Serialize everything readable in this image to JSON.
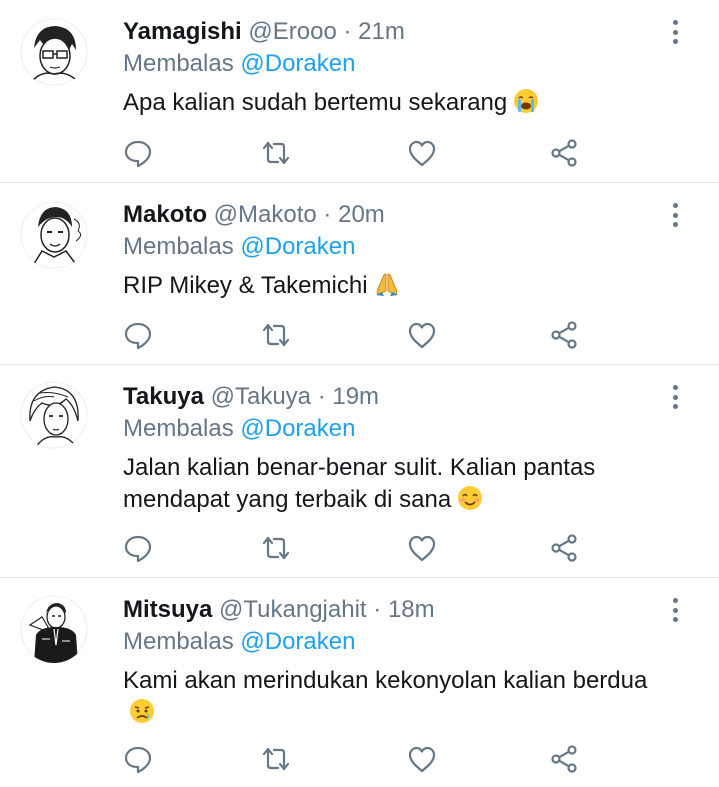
{
  "tweets": [
    {
      "name": "Yamagishi",
      "handle": "@Erooo",
      "separator": "·",
      "time": "21m",
      "reply_prefix": "Membalas",
      "reply_to": "@Doraken",
      "text": "Apa kalian sudah bertemu sekarang",
      "emoji": "loudly-crying-face",
      "avatar_icon": "manga-avatar-glasses"
    },
    {
      "name": "Makoto",
      "handle": "@Makoto",
      "separator": "·",
      "time": "20m",
      "reply_prefix": "Membalas",
      "reply_to": "@Doraken",
      "text": "RIP Mikey & Takemichi",
      "emoji": "folded-hands",
      "avatar_icon": "manga-avatar-slick-hair"
    },
    {
      "name": "Takuya",
      "handle": "@Takuya",
      "separator": "·",
      "time": "19m",
      "reply_prefix": "Membalas",
      "reply_to": "@Doraken",
      "text": "Jalan kalian benar-benar sulit. Kalian pantas mendapat yang terbaik di sana",
      "emoji": "smiling-face",
      "avatar_icon": "manga-avatar-long-hair"
    },
    {
      "name": "Mitsuya",
      "handle": "@Tukangjahit",
      "separator": "·",
      "time": "18m",
      "reply_prefix": "Membalas",
      "reply_to": "@Doraken",
      "text": "Kami akan merindukan kekonyolan kalian berdua",
      "emoji": "sad-face",
      "avatar_icon": "manga-avatar-dark-jacket"
    }
  ],
  "actions": [
    "reply-icon",
    "retweet-icon",
    "like-icon",
    "share-icon"
  ],
  "colors": {
    "text": "#14171a",
    "secondary": "#657786",
    "mention": "#1da1f2",
    "divider": "#e1e8ed"
  }
}
